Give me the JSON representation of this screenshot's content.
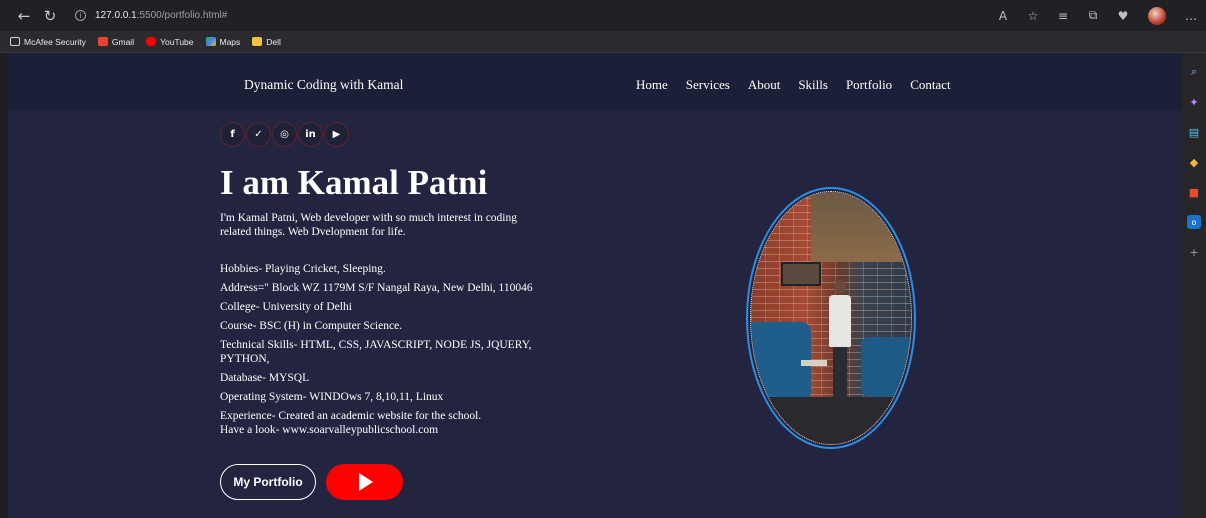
{
  "browser": {
    "url_host": "127.0.0.1",
    "url_rest": ":5500/portfolio.html#",
    "bookmarks": [
      "McAfee Security",
      "Gmail",
      "YouTube",
      "Maps",
      "Dell"
    ]
  },
  "site": {
    "brand": "Dynamic Coding with Kamal",
    "menu": [
      "Home",
      "Services",
      "About",
      "Skills",
      "Portfolio",
      "Contact"
    ],
    "socials": [
      "facebook-icon",
      "twitter-icon",
      "instagram-icon",
      "linkedin-icon",
      "youtube-icon"
    ]
  },
  "hero": {
    "title": "I am Kamal Patni",
    "intro": "I'm Kamal Patni, Web developer with so much interest in coding related things. Web Dvelopment for life.",
    "details": [
      "Hobbies- Playing Cricket, Sleeping.",
      "Address=\" Block WZ 1179M S/F Nangal Raya, New Delhi, 110046",
      "College- University of Delhi",
      "Course- BSC (H) in Computer Science.",
      "Technical Skills- HTML, CSS, JAVASCRIPT, NODE JS, JQUERY, PYTHON,",
      "Database- MYSQL",
      "Operating System- WINDOws 7, 8,10,11, Linux",
      "Experience- Created an academic website for the school.",
      "Have a look-    www.soarvalleypublicschool.com"
    ],
    "portfolio_button": "My Portfolio"
  },
  "colors": {
    "page_bg": "#222440",
    "navbar_bg": "#1c1f38",
    "play_button": "#ff0000",
    "photo_border": "#2e8fe0"
  }
}
